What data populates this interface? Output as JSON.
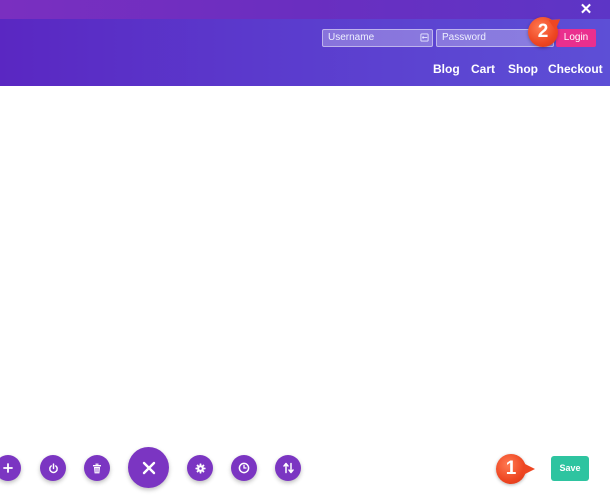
{
  "header": {
    "username_placeholder": "Username",
    "password_placeholder": "Password",
    "login_label": "Login",
    "nav": [
      "Blog",
      "Cart",
      "Shop",
      "Checkout"
    ],
    "close_glyph": "✕"
  },
  "annotations": {
    "marker_1": "1",
    "marker_2": "2"
  },
  "toolbar": {
    "save_label": "Save",
    "icons": [
      "plus-icon",
      "power-icon",
      "trash-icon",
      "close-icon",
      "gear-icon",
      "clock-icon",
      "sort-icon"
    ]
  },
  "colors": {
    "header_purple": "#5b3bcd",
    "topbar_purple": "#6a2ec0",
    "login_pink": "#ea2f8e",
    "save_green": "#2ec4a0",
    "toolbar_purple": "#7b35c2",
    "marker_orange": "#ee4622"
  }
}
